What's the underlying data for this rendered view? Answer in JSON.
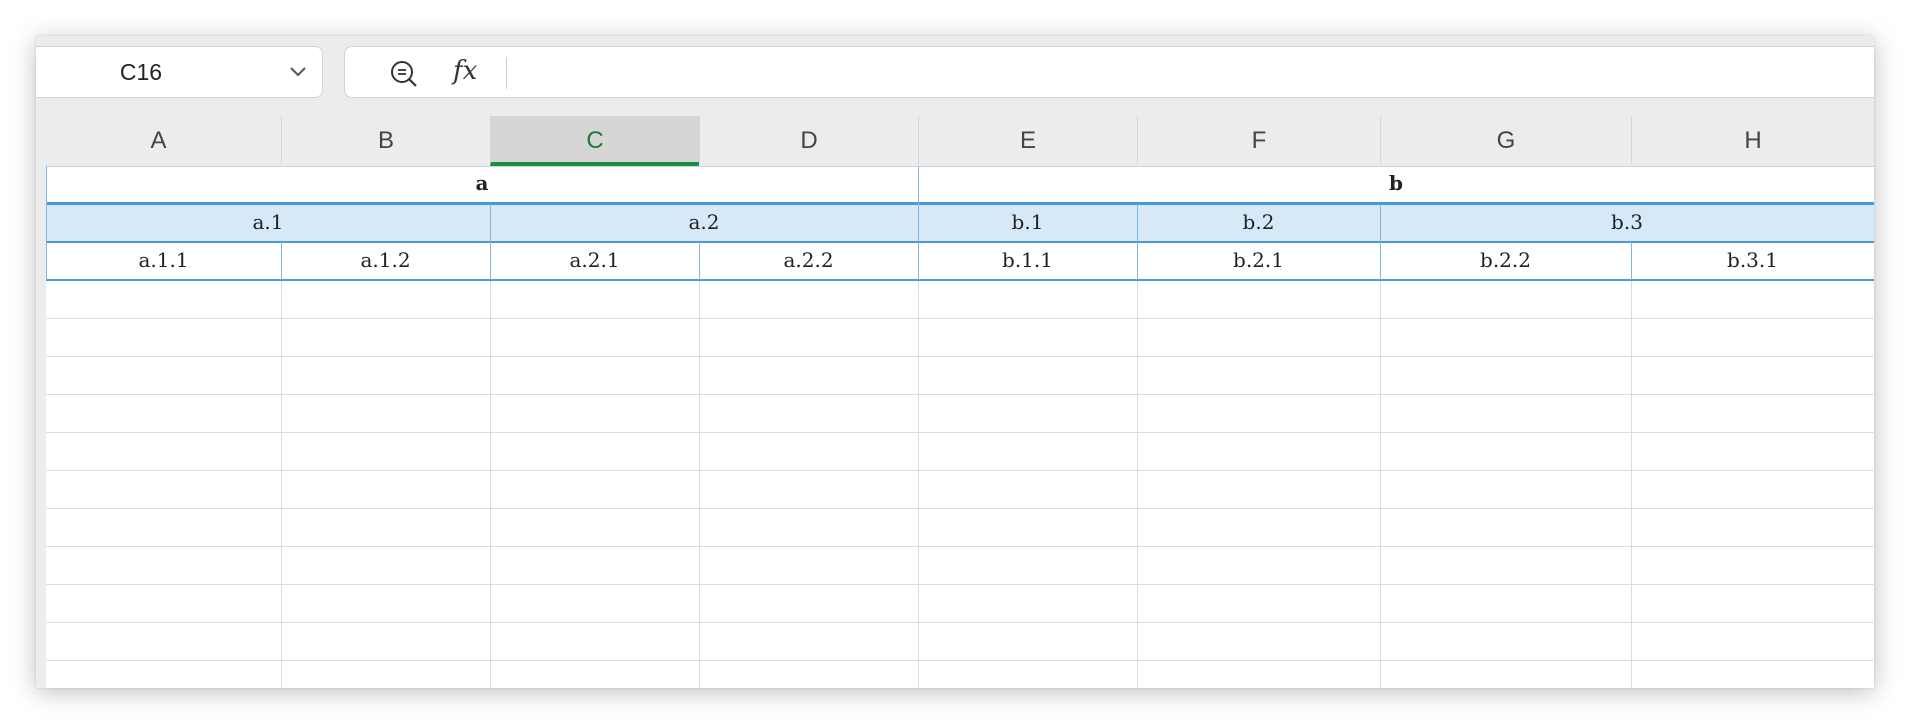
{
  "name_box": {
    "value": "C16"
  },
  "formula_bar": {
    "fx_label": "fx",
    "value": ""
  },
  "columns": [
    "A",
    "B",
    "C",
    "D",
    "E",
    "F",
    "G",
    "H"
  ],
  "selected_column": "C",
  "header_rows": {
    "level1": [
      "a",
      "b"
    ],
    "level2": [
      "a.1",
      "a.2",
      "b.1",
      "b.2",
      "b.3"
    ],
    "level3": [
      "a.1.1",
      "a.1.2",
      "a.2.1",
      "a.2.2",
      "b.1.1",
      "b.2.1",
      "b.2.2",
      "b.3.1"
    ]
  },
  "colors": {
    "header_band": "#d6e9f8",
    "header_border": "#4a9ad6",
    "selected_column_accent": "#1e8c3a"
  }
}
